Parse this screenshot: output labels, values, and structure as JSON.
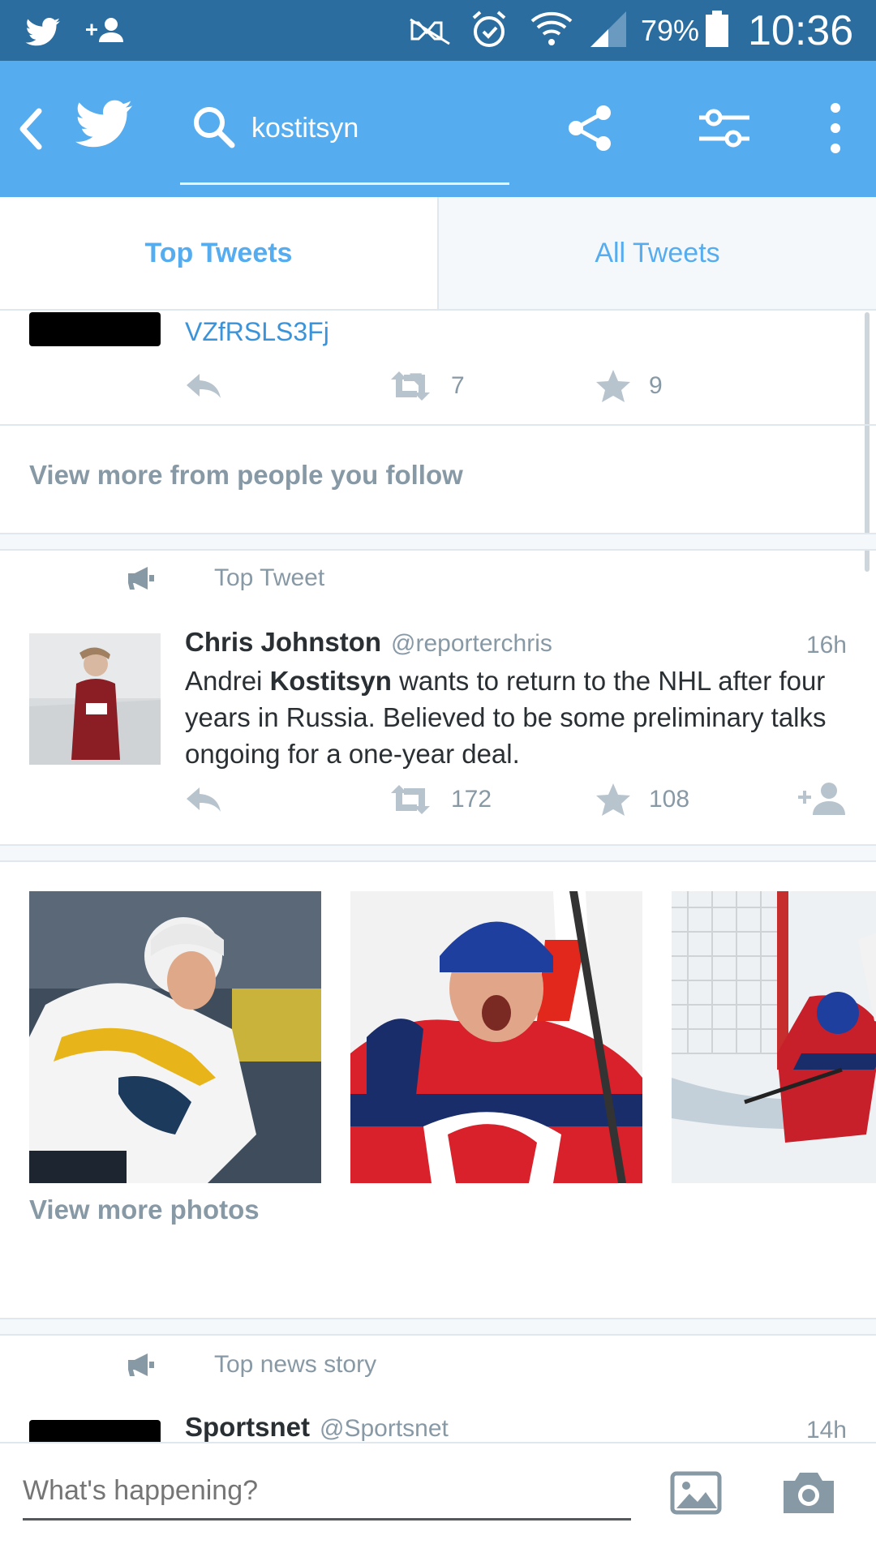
{
  "status_bar": {
    "battery": "79%",
    "time": "10:36",
    "icons": [
      "twitter-icon",
      "add-user-icon",
      "nfc-muted-icon",
      "alarm-icon",
      "wifi-icon",
      "signal-icon",
      "battery-icon"
    ]
  },
  "action_bar": {
    "search_query": "kostitsyn",
    "icons": [
      "back-icon",
      "twitter-logo-icon",
      "search-icon",
      "share-icon",
      "filter-icon",
      "overflow-menu-icon"
    ],
    "accent": "#55acee"
  },
  "tabs": [
    {
      "label": "Top Tweets",
      "selected": true
    },
    {
      "label": "All Tweets",
      "selected": false
    }
  ],
  "partial_tweet": {
    "link_text": "VZfRSLS3Fj",
    "retweets": "7",
    "favorites": "9"
  },
  "view_more_follow": "View more from people you follow",
  "top_tweet": {
    "context": "Top Tweet",
    "name": "Chris Johnston",
    "handle": "@reporterchris",
    "time": "16h",
    "text_before": "Andrei ",
    "text_bold": "Kostitsyn",
    "text_after": " wants to return to the NHL after four years in Russia. Believed to be some preliminary talks ongoing for a one-year deal.",
    "retweets": "172",
    "favorites": "108"
  },
  "photos": [
    "hockey-player-predators-photo",
    "hockey-player-canadiens-photo",
    "hockey-goal-crease-photo"
  ],
  "view_more_photos": "View more photos",
  "news_story": {
    "context": "Top news story",
    "name": "Sportsnet",
    "handle": "@Sportsnet",
    "time": "14h"
  },
  "compose": {
    "placeholder": "What's happening?",
    "icons": [
      "image-icon",
      "camera-icon"
    ]
  }
}
